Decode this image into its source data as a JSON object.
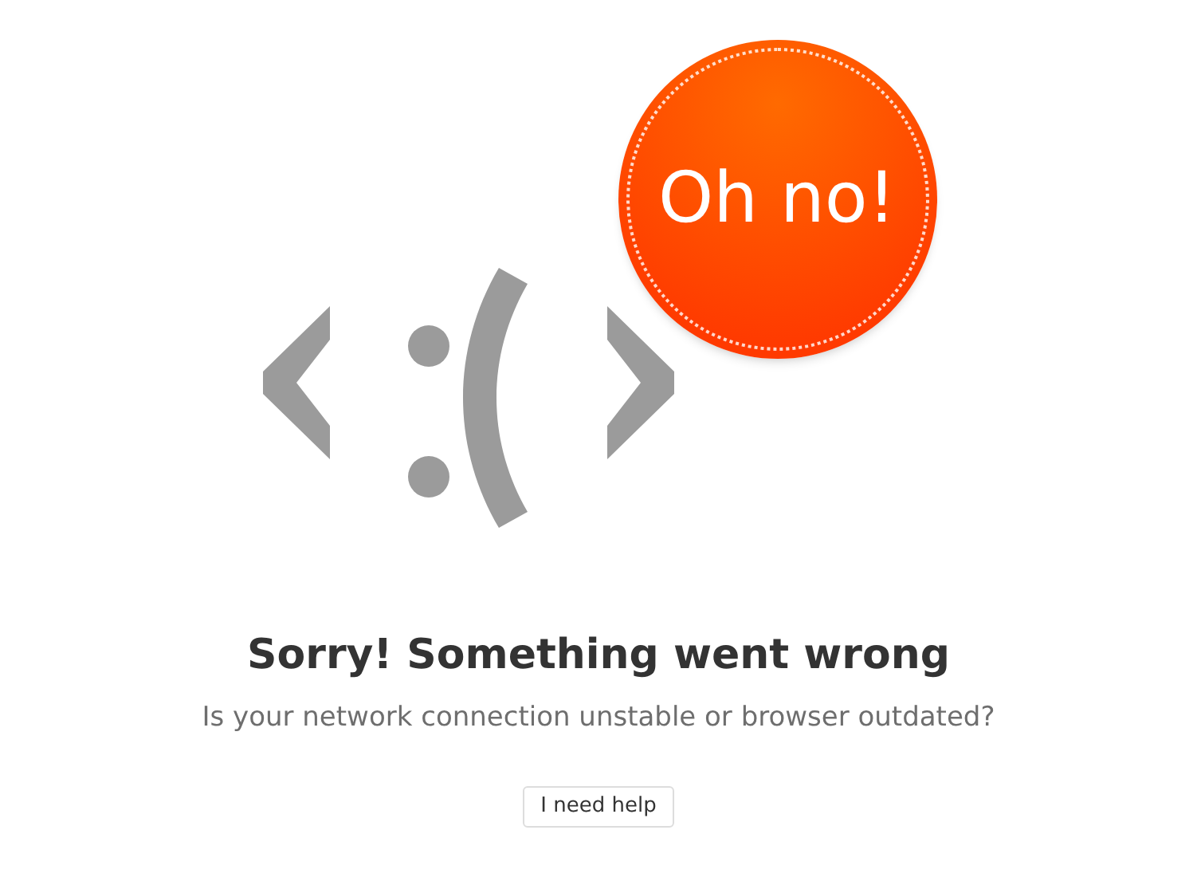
{
  "badge": {
    "text": "Oh no!"
  },
  "heading": "Sorry! Something went wrong",
  "message": "Is your network connection unstable or browser outdated?",
  "help_button": {
    "label": "I need help"
  }
}
